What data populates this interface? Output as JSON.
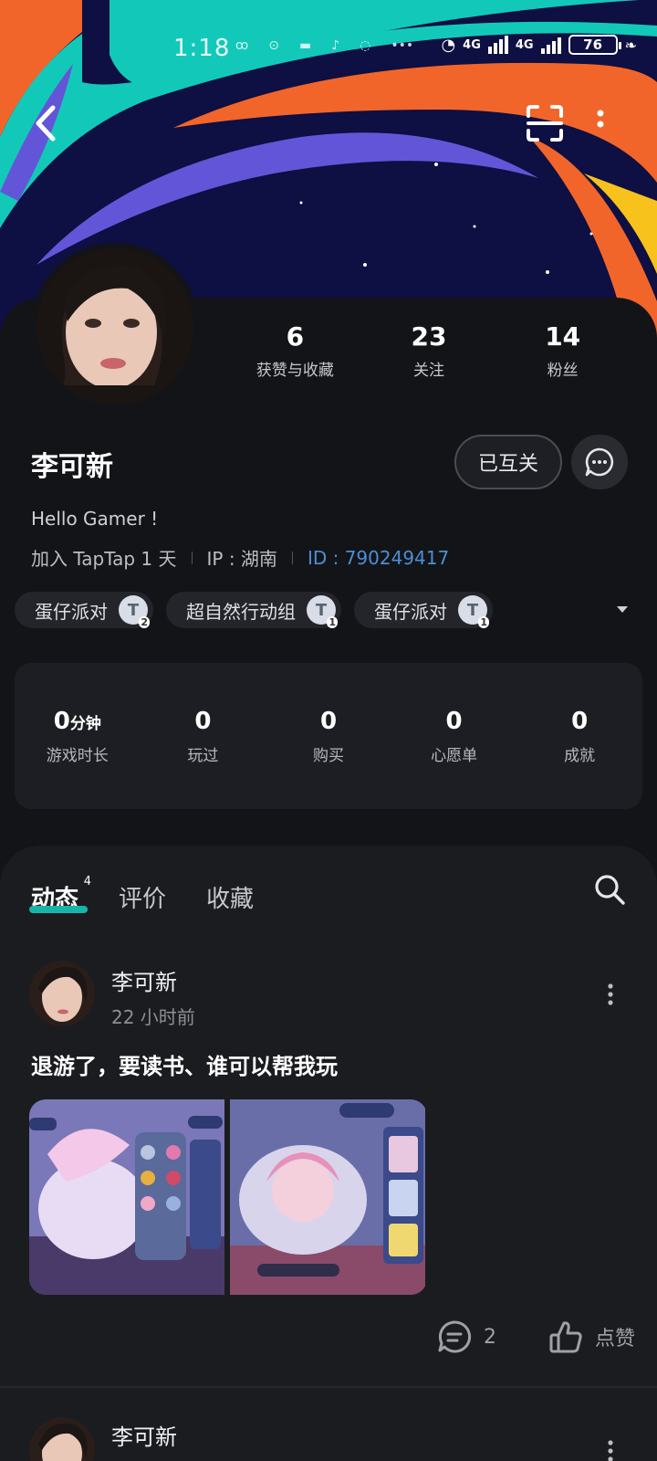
{
  "status_bar": {
    "time": "1:18",
    "network_1": "4G",
    "network_2": "4G",
    "battery": "76"
  },
  "profile": {
    "name": "李可新",
    "bio": "Hello Gamer !",
    "joined": "加入 TapTap 1 天",
    "ip": "IP : 湖南",
    "id": "ID : 790249417",
    "mutual_button": "已互关",
    "stats": [
      {
        "value": "6",
        "label": "获赞与收藏"
      },
      {
        "value": "23",
        "label": "关注"
      },
      {
        "value": "14",
        "label": "粉丝"
      }
    ],
    "games": [
      {
        "name": "蛋仔派对",
        "badge": "2"
      },
      {
        "name": "超自然行动组",
        "badge": "1"
      },
      {
        "name": "蛋仔派对",
        "badge": "1"
      }
    ],
    "game_stats": [
      {
        "value": "0",
        "unit": "分钟",
        "label": "游戏时长"
      },
      {
        "value": "0",
        "unit": "",
        "label": "玩过"
      },
      {
        "value": "0",
        "unit": "",
        "label": "购买"
      },
      {
        "value": "0",
        "unit": "",
        "label": "心愿单"
      },
      {
        "value": "0",
        "unit": "",
        "label": "成就"
      }
    ]
  },
  "tabs": [
    {
      "label": "动态",
      "count": "4"
    },
    {
      "label": "评价"
    },
    {
      "label": "收藏"
    }
  ],
  "posts": [
    {
      "author": "李可新",
      "time": "22 小时前",
      "text": "退游了，要读书、谁可以帮我玩",
      "comments": "2",
      "like_label": "点赞"
    },
    {
      "author": "李可新"
    }
  ],
  "colors": {
    "accent": "#17b5a8",
    "id_link": "#4a8fd6",
    "background": "#131417"
  }
}
